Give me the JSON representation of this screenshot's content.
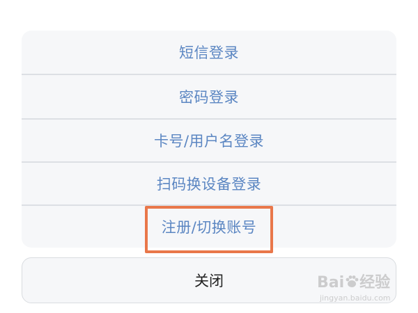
{
  "action_sheet": {
    "options": [
      {
        "label": "短信登录"
      },
      {
        "label": "密码登录"
      },
      {
        "label": "卡号/用户名登录"
      },
      {
        "label": "扫码换设备登录"
      },
      {
        "label": "注册/切换账号"
      }
    ],
    "close_label": "关闭",
    "highlighted_option": "注册/切换账号"
  },
  "colors": {
    "option_text": "#5b86c2",
    "sheet_background": "#f6f7f9",
    "highlight_border": "#e9774a",
    "close_text": "#222222"
  },
  "watermark": {
    "brand_prefix": "Bai",
    "brand_suffix": "经验",
    "site": "jingyan.baidu.com"
  }
}
